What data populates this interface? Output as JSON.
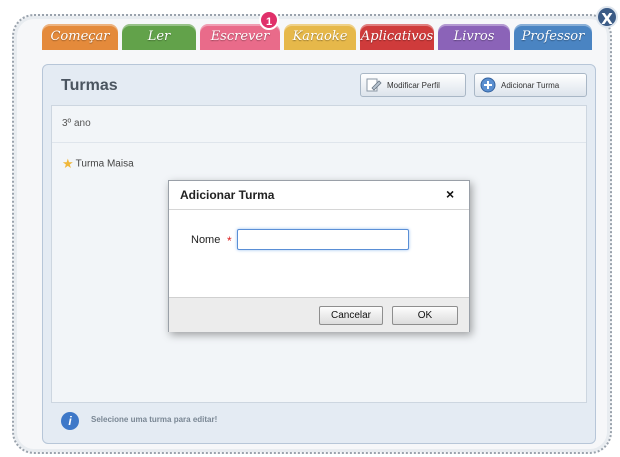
{
  "window": {
    "close_label": "X"
  },
  "tabs": [
    {
      "label": "Começar",
      "color": "#e48a3b"
    },
    {
      "label": "Ler",
      "color": "#62a24a"
    },
    {
      "label": "Escrever",
      "color": "#e96b8a"
    },
    {
      "label": "Karaoke",
      "color": "#e6b84a"
    },
    {
      "label": "Aplicativos",
      "color": "#cf3b3b"
    },
    {
      "label": "Livros",
      "color": "#8b63b8"
    },
    {
      "label": "Professor",
      "color": "#4a84c2"
    }
  ],
  "notification_badge": "1",
  "panel": {
    "title": "Turmas",
    "edit_profile_label": "Modificar Perfil",
    "add_class_label": "Adicionar Turma",
    "year_label": "3º ano",
    "class_name": "Turma Maisa",
    "status_text": "Selecione uma turma para editar!"
  },
  "dialog": {
    "title": "Adicionar Turma",
    "close_symbol": "×",
    "name_label": "Nome",
    "required_marker": "*",
    "name_value": "",
    "cancel_label": "Cancelar",
    "ok_label": "OK"
  },
  "icons": {
    "edit_profile": "edit-profile-icon",
    "add_class": "add-icon",
    "star": "star-icon",
    "info": "info-icon"
  }
}
